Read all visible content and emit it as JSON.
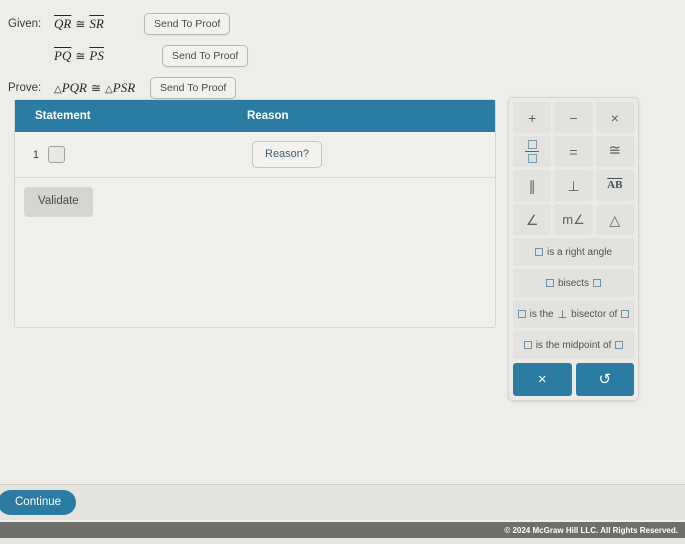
{
  "given": {
    "label_given": "Given:",
    "label_prove": "Prove:",
    "lines": [
      {
        "seg_a": "QR",
        "rel": "≅",
        "seg_b": "SR",
        "button": "Send To Proof"
      },
      {
        "seg_a": "PQ",
        "rel": "≅",
        "seg_b": "PS",
        "button": "Send To Proof"
      }
    ],
    "prove": {
      "tri": "△",
      "a": "PQR",
      "rel": "≅",
      "b": "PSR",
      "button": "Send To Proof"
    }
  },
  "proof": {
    "col_statement": "Statement",
    "col_reason": "Reason",
    "rows": [
      {
        "num": "1",
        "statement": "",
        "reason_button": "Reason?"
      }
    ],
    "validate_label": "Validate"
  },
  "keypad": {
    "keys": [
      {
        "name": "plus-key",
        "glyph": "+"
      },
      {
        "name": "minus-key",
        "glyph": "−"
      },
      {
        "name": "multiply-key",
        "glyph": "×"
      },
      {
        "name": "fraction-key",
        "glyph": ""
      },
      {
        "name": "equals-key",
        "glyph": "="
      },
      {
        "name": "congruent-key",
        "glyph": "≅"
      },
      {
        "name": "parallel-key",
        "glyph": "∥"
      },
      {
        "name": "perpendicular-key",
        "glyph": "⊥"
      },
      {
        "name": "segment-ab-key",
        "glyph": "AB"
      },
      {
        "name": "angle-key",
        "glyph": "∠"
      },
      {
        "name": "measure-angle-key",
        "glyph": "m∠"
      },
      {
        "name": "triangle-key",
        "glyph": "△"
      }
    ],
    "phrases": [
      {
        "name": "is-a-right-angle-phrase",
        "pre_box": true,
        "text": "is a right angle",
        "post_box": false
      },
      {
        "name": "bisects-phrase",
        "pre_box": true,
        "text": "bisects",
        "post_box": true
      },
      {
        "name": "perpendicular-bisector-phrase",
        "pre_box": true,
        "text_before": "is the",
        "perp": "⊥",
        "text_after": "bisector of",
        "post_box": true
      },
      {
        "name": "is-the-midpoint-of-phrase",
        "pre_box": true,
        "text": "is the midpoint of",
        "post_box": true
      }
    ],
    "actions": [
      {
        "name": "clear-button",
        "glyph": "×"
      },
      {
        "name": "undo-button",
        "glyph": "↺"
      }
    ]
  },
  "bottom": {
    "continue_label": "Continue",
    "copyright": "© 2024 McGraw Hill LLC. All Rights Reserved."
  },
  "colors": {
    "accent_teal": "#2b7ca2",
    "panel_key": "#e3e2de",
    "footer_gray": "#6e6e6b"
  }
}
